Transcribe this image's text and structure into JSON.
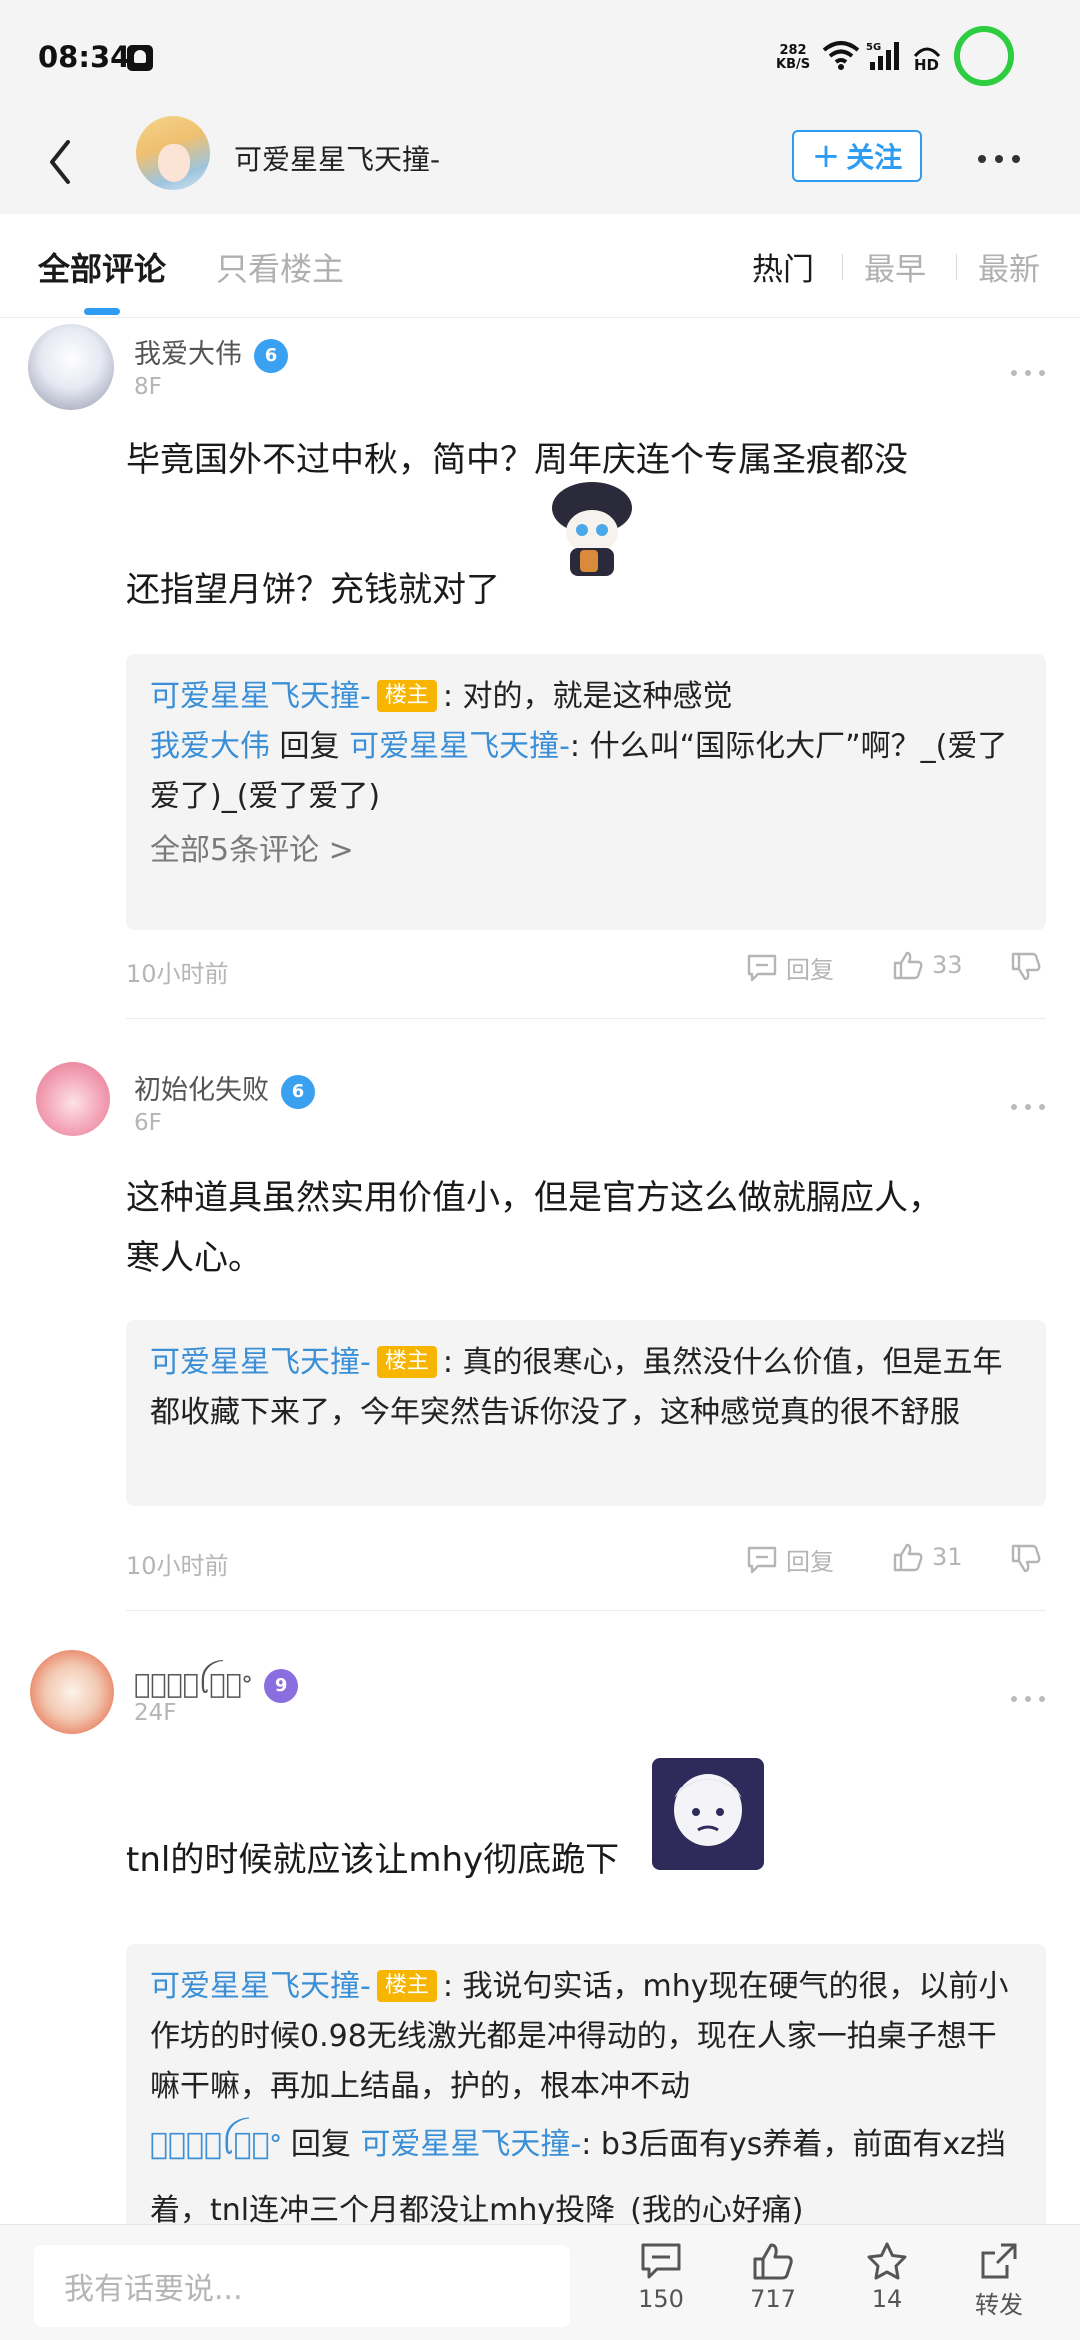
{
  "status_bar": {
    "time": "08:34",
    "speed_value": "282",
    "speed_unit": "KB/S"
  },
  "header": {
    "title": "可爱星星飞天撞-",
    "follow_label": "关注"
  },
  "filter": {
    "tab_all": "全部评论",
    "tab_owner": "只看楼主",
    "sort_hot": "热门",
    "sort_early": "最早",
    "sort_new": "最新"
  },
  "comments": [
    {
      "name": "我爱大伟",
      "level": "6",
      "floor": "8F",
      "text_line1": "毕竟国外不过中秋，简中？周年庆连个专属圣痕都没",
      "text_line2": "还指望月饼？充钱就对了",
      "replies": [
        {
          "name": "可爱星星飞天撞-",
          "tag": "楼主",
          "text": ": 对的，就是这种感觉"
        },
        {
          "name": "我爱大伟",
          "reply_word": "回复",
          "target": "可爱星星飞天撞-",
          "text": ": 什么叫“国际化大厂”啊？_(爱了爱了)_(爱了爱了)"
        }
      ],
      "view_all": "全部5条评论",
      "time": "10小时前",
      "reply_label": "回复",
      "likes": "33"
    },
    {
      "name": "初始化失败",
      "level": "6",
      "floor": "6F",
      "text": "这种道具虽然实用价值小，但是官方这么做就膈应人，寒人心。",
      "replies": [
        {
          "name": "可爱星星飞天撞-",
          "tag": "楼主",
          "text": ": 真的很寒心，虽然没什么价值，但是五年都收藏下来了，今年突然告诉你没了，这种感觉真的很不舒服"
        }
      ],
      "time": "10小时前",
      "reply_label": "回复",
      "likes": "31"
    },
    {
      "name": "无᷂名᷂ꪶ氏᷂ᐤ",
      "level": "9",
      "floor": "24F",
      "text": "tnl的时候就应该让mhy彻底跪下",
      "replies": [
        {
          "name": "可爱星星飞天撞-",
          "tag": "楼主",
          "text": ": 我说句实话，mhy现在硬气的很，以前小作坊的时候0.98无线激光都是冲得动的，现在人家一拍桌子想干嘛干嘛，再加上结晶，护的，根本冲不动"
        },
        {
          "name": "无᷂名᷂ꪶ氏᷂ᐤ",
          "reply_word": "回复",
          "target": "可爱星星飞天撞-",
          "text": ": b3后面有ys养着，前面有xz挡着，tnl连冲三个月都没让mhy投降_(我的心好痛)"
        }
      ]
    }
  ],
  "bottom_bar": {
    "input_placeholder": "我有话要说...",
    "comments_count": "150",
    "likes_count": "717",
    "favorites_count": "14",
    "share_label": "转发"
  },
  "colors": {
    "accent": "#2d9cf2",
    "owner_tag": "#f7b500",
    "level6": "#3aa0f0",
    "level9": "#8a6ee0"
  }
}
